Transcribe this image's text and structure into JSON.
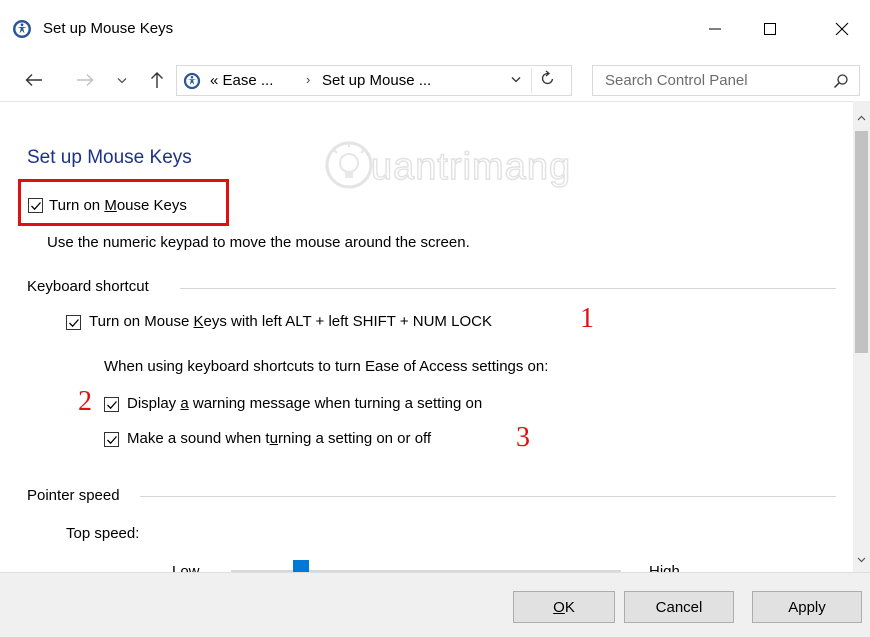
{
  "window": {
    "title": "Set up Mouse Keys"
  },
  "address_bar": {
    "crumb_prefix": "«",
    "crumb1": "Ease ...",
    "separator": "›",
    "crumb2": "Set up Mouse ...",
    "search_placeholder": "Search Control Panel"
  },
  "page": {
    "title": "Set up Mouse Keys",
    "watermark": "Quantrimang",
    "main_checkbox": {
      "label_pre": "Turn on ",
      "label_u": "M",
      "label_post": "ouse Keys",
      "checked": true
    },
    "description": "Use the numeric keypad to move the mouse around the screen.",
    "keyboard_shortcut": {
      "heading": "Keyboard shortcut",
      "shortcut_checkbox": {
        "label_pre": "Turn on Mouse ",
        "label_u": "K",
        "label_post": "eys with left ALT + left SHIFT + NUM LOCK",
        "checked": true
      },
      "info": "When using keyboard shortcuts to turn Ease of Access settings on:",
      "warning_checkbox": {
        "label_pre": "Display ",
        "label_u": "a",
        "label_post": " warning message when turning a setting on",
        "checked": true
      },
      "sound_checkbox": {
        "label_pre": "Make a sound when t",
        "label_u": "u",
        "label_post": "rning a setting on or off",
        "checked": true
      }
    },
    "annotations": [
      "1",
      "2",
      "3"
    ],
    "pointer_speed": {
      "heading": "Pointer speed",
      "top_speed_label": "Top speed:",
      "low_label": "Low",
      "high_label": "High",
      "level": 0.17
    }
  },
  "footer": {
    "ok_u": "O",
    "ok_rest": "K",
    "cancel": "Cancel",
    "apply": "Apply"
  },
  "colors": {
    "title_blue": "#1e3287",
    "highlight_red": "#e01010",
    "slider_blue": "#0078d7"
  }
}
